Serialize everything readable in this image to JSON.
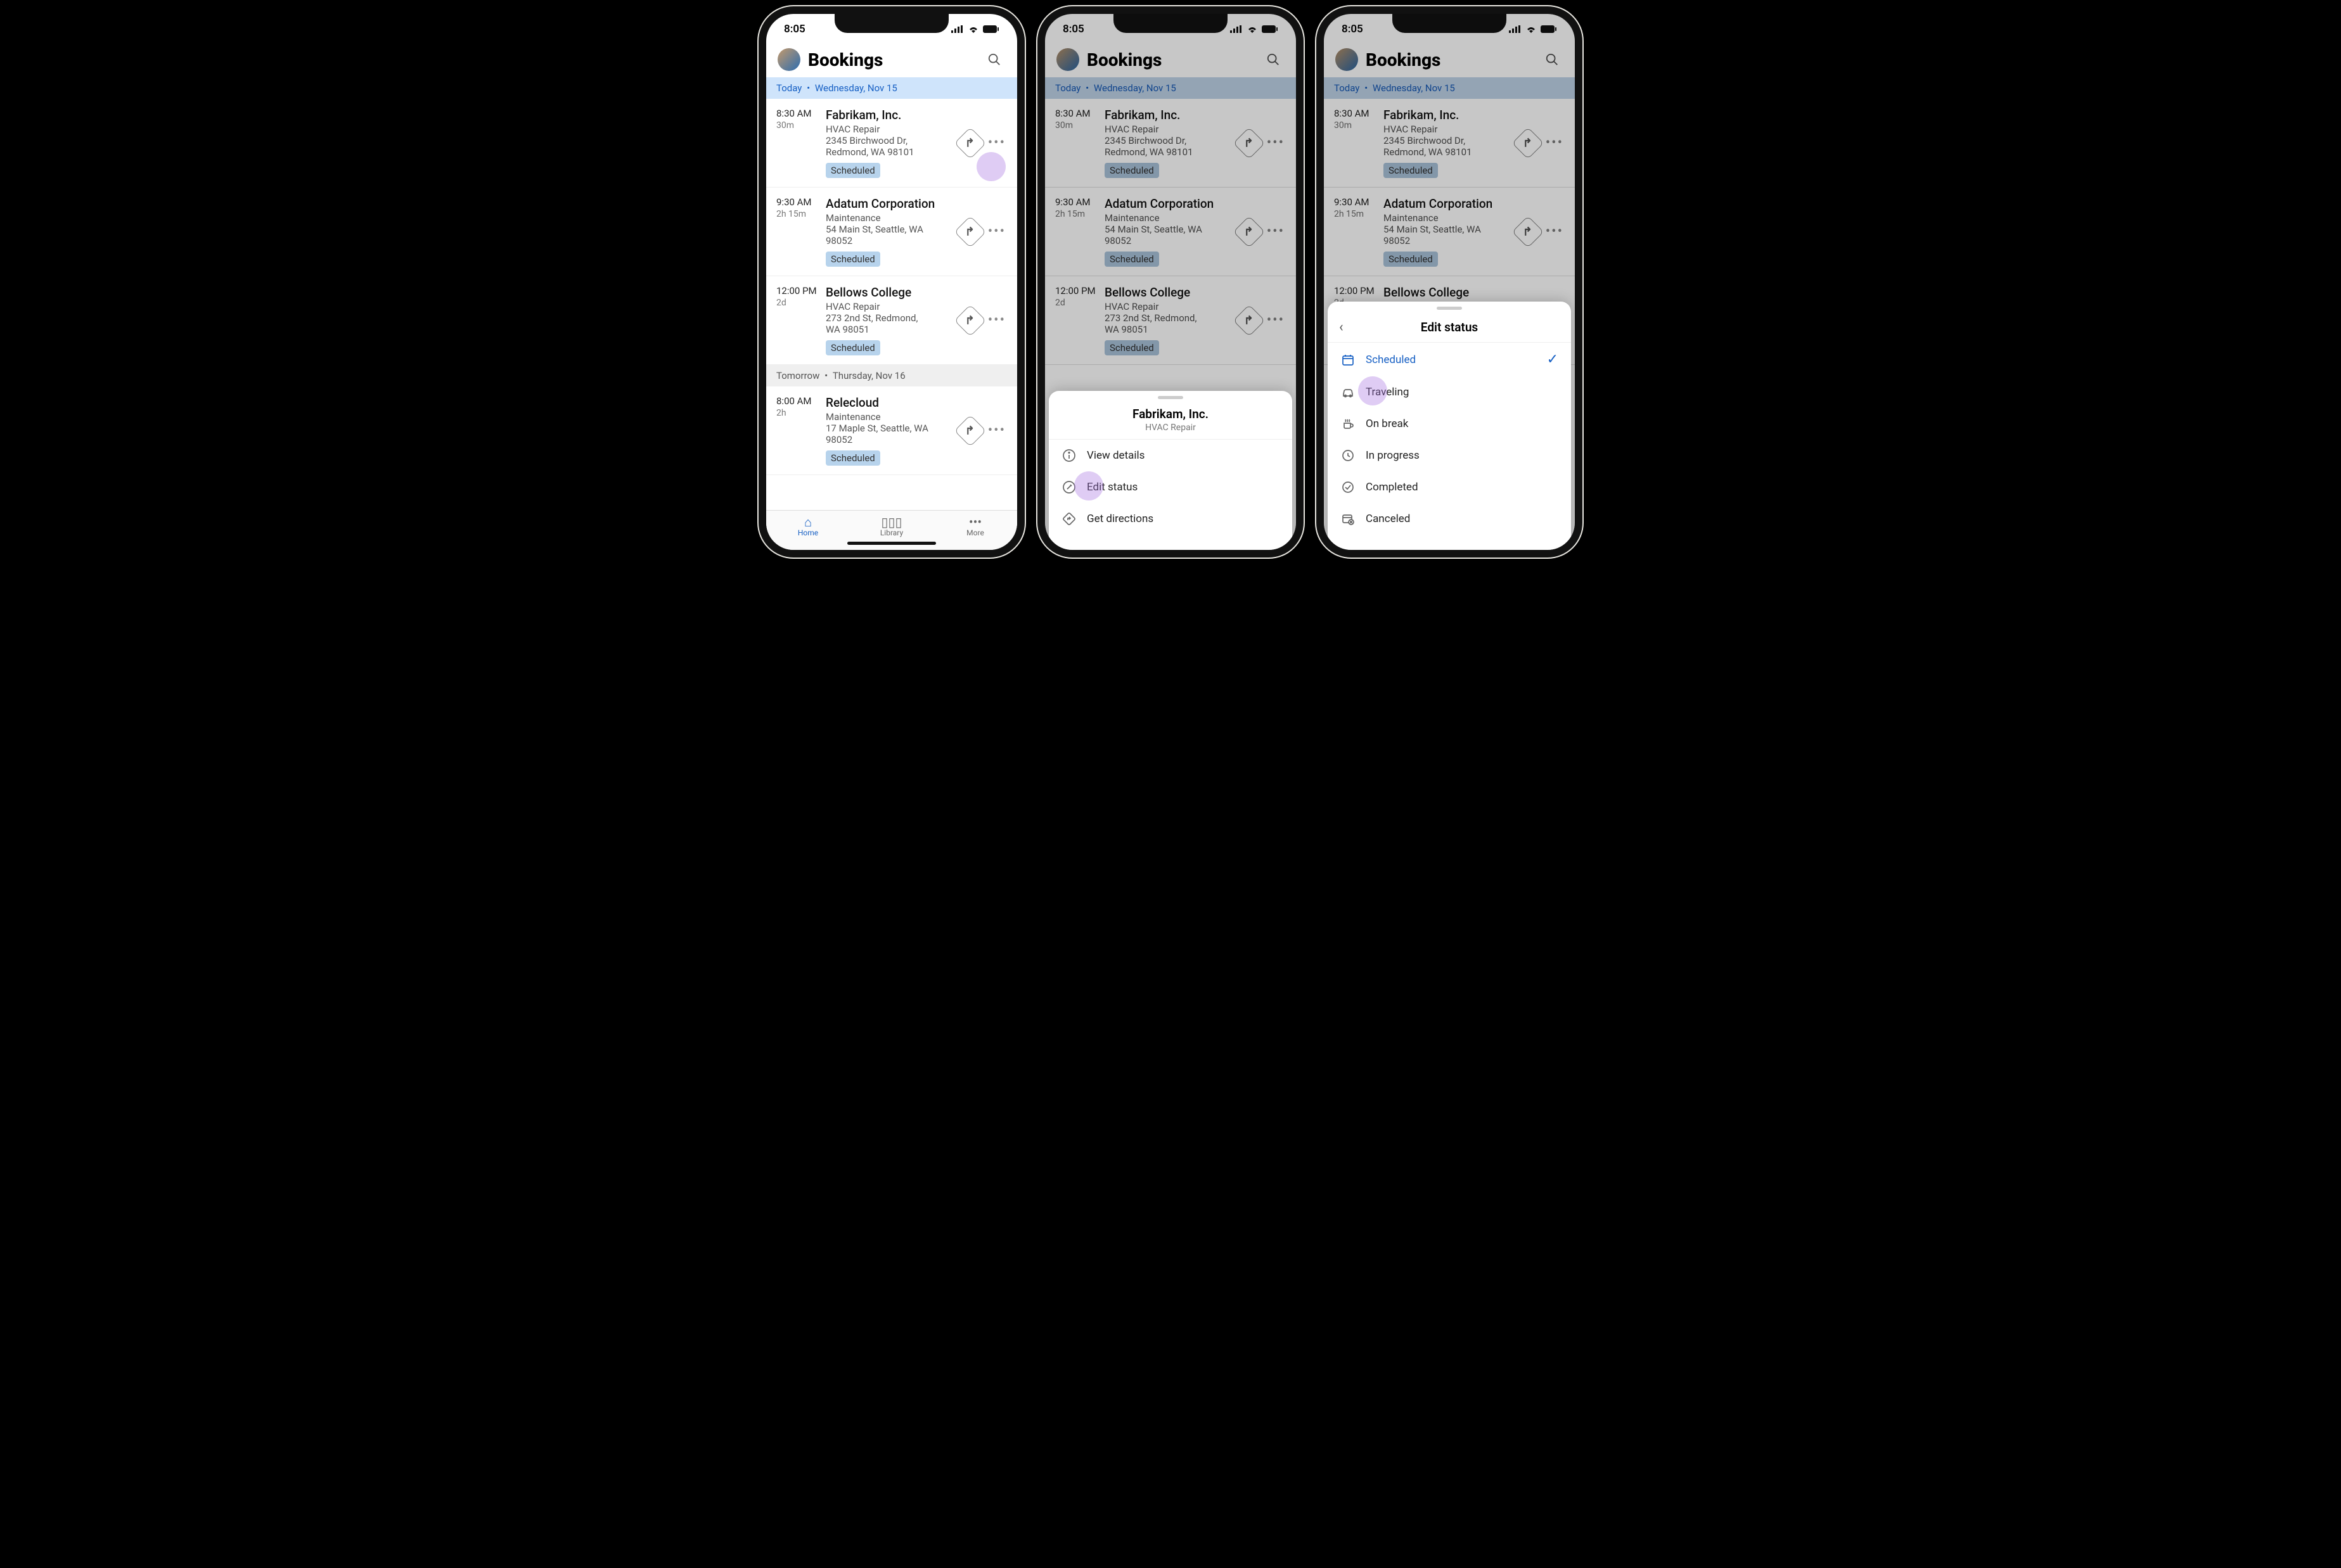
{
  "status_time": "8:05",
  "header": {
    "title": "Bookings"
  },
  "sections": [
    {
      "label_a": "Today",
      "label_b": "Wednesday, Nov 15",
      "style": "blue",
      "items": [
        {
          "time": "8:30 AM",
          "dur": "30m",
          "name": "Fabrikam, Inc.",
          "service": "HVAC Repair",
          "addr1": "2345 Birchwood Dr,",
          "addr2": "Redmond, WA 98101",
          "status": "Scheduled"
        },
        {
          "time": "9:30 AM",
          "dur": "2h 15m",
          "name": "Adatum Corporation",
          "service": "Maintenance",
          "addr1": "54 Main St, Seattle, WA",
          "addr2": "98052",
          "status": "Scheduled"
        },
        {
          "time": "12:00 PM",
          "dur": "2d",
          "name": "Bellows College",
          "service": "HVAC Repair",
          "addr1": "273 2nd St, Redmond,",
          "addr2": "WA 98051",
          "status": "Scheduled"
        }
      ]
    },
    {
      "label_a": "Tomorrow",
      "label_b": "Thursday, Nov 16",
      "style": "gray",
      "items": [
        {
          "time": "8:00 AM",
          "dur": "2h",
          "name": "Relecloud",
          "service": "Maintenance",
          "addr1": "17 Maple St, Seattle, WA",
          "addr2": "98052",
          "status": "Scheduled"
        }
      ]
    }
  ],
  "nav": {
    "home": "Home",
    "library": "Library",
    "more": "More"
  },
  "action_sheet": {
    "title": "Fabrikam, Inc.",
    "subtitle": "HVAC Repair",
    "view": "View details",
    "edit": "Edit status",
    "dir": "Get directions"
  },
  "status_sheet": {
    "title": "Edit status",
    "options": [
      {
        "icon": "calendar",
        "label": "Scheduled",
        "selected": true
      },
      {
        "icon": "car",
        "label": "Traveling"
      },
      {
        "icon": "cup",
        "label": "On break"
      },
      {
        "icon": "clock",
        "label": "In progress"
      },
      {
        "icon": "check",
        "label": "Completed"
      },
      {
        "icon": "cancel",
        "label": "Canceled"
      }
    ]
  }
}
